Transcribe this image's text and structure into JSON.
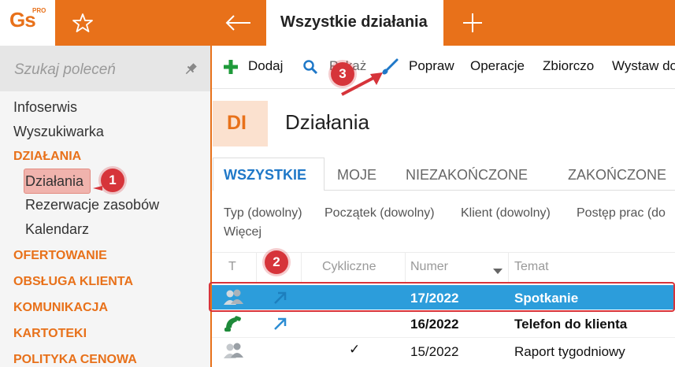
{
  "app": {
    "logo_text": "Gs",
    "logo_sup": "PRO"
  },
  "header": {
    "active_tab": "Wszystkie działania"
  },
  "sidebar": {
    "search_placeholder": "Szukaj poleceń",
    "items": [
      {
        "label": "Infoserwis"
      },
      {
        "label": "Wyszukiwarka"
      },
      {
        "label": "DZIAŁANIA"
      },
      {
        "label": "Działania"
      },
      {
        "label": "Rezerwacje zasobów"
      },
      {
        "label": "Kalendarz"
      },
      {
        "label": "OFERTOWANIE"
      },
      {
        "label": "OBSŁUGA KLIENTA"
      },
      {
        "label": "KOMUNIKACJA"
      },
      {
        "label": "KARTOTEKI"
      },
      {
        "label": "POLITYKA CENOWA"
      }
    ]
  },
  "toolbar": {
    "add": "Dodaj",
    "show": "Pokaż",
    "fix": "Popraw",
    "operations": "Operacje",
    "bulk": "Zbiorczo",
    "issue": "Wystaw do"
  },
  "page": {
    "badge": "DI",
    "title": "Działania"
  },
  "view_tabs": [
    "WSZYSTKIE",
    "MOJE",
    "NIEZAKOŃCZONE",
    "ZAKOŃCZONE"
  ],
  "filters": [
    "Typ (dowolny)",
    "Początek (dowolny)",
    "Klient (dowolny)",
    "Postęp prac (do",
    "Więcej"
  ],
  "grid": {
    "columns": [
      "T",
      "Cykliczne",
      "Numer",
      "Temat"
    ],
    "rows": [
      {
        "type_icon": "people-icon",
        "link_icon": "arrow-up-right-icon",
        "cyclic": "",
        "number": "17/2022",
        "subject": "Spotkanie",
        "selected": true
      },
      {
        "type_icon": "phone-icon",
        "link_icon": "arrow-up-right-icon",
        "cyclic": "",
        "number": "16/2022",
        "subject": "Telefon do klienta",
        "selected": false
      },
      {
        "type_icon": "people-icon",
        "link_icon": "",
        "cyclic": "✓",
        "number": "15/2022",
        "subject": "Raport tygodniowy",
        "selected": false
      }
    ]
  },
  "annotations": [
    "1",
    "2",
    "3"
  ],
  "colors": {
    "accent": "#e8711a",
    "selection": "#2c9ddb",
    "marker": "#d6343a",
    "add_green": "#1e9a3a"
  }
}
